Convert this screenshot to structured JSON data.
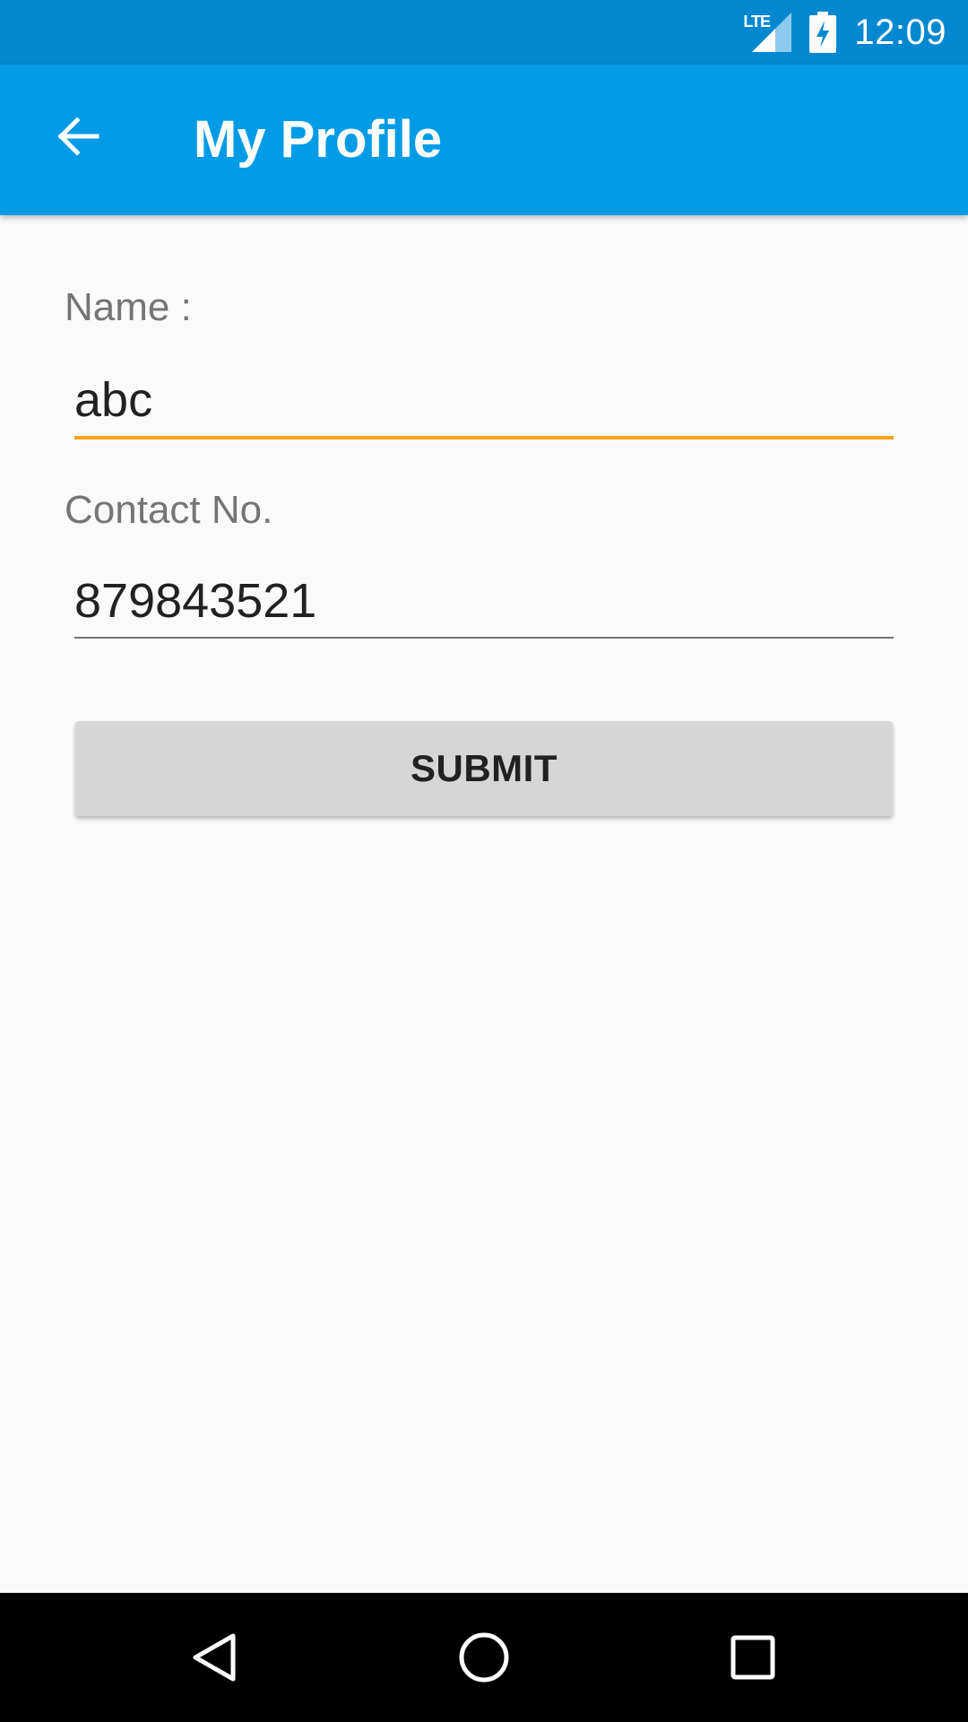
{
  "status_bar": {
    "network": "LTE",
    "time": "12:09",
    "icons": [
      "lte-signal-icon",
      "battery-charging-icon"
    ]
  },
  "app_bar": {
    "title": "My Profile",
    "back_icon": "arrow-back-icon",
    "color": "#039be5"
  },
  "form": {
    "name_label": "Name :",
    "name_value": "abc",
    "contact_label": "Contact No.",
    "contact_value": "879843521",
    "submit_label": "SUBMIT",
    "focus_color": "#f9a51b"
  },
  "nav_bar": {
    "icons": [
      "back-triangle-icon",
      "home-circle-icon",
      "recents-square-icon"
    ]
  }
}
